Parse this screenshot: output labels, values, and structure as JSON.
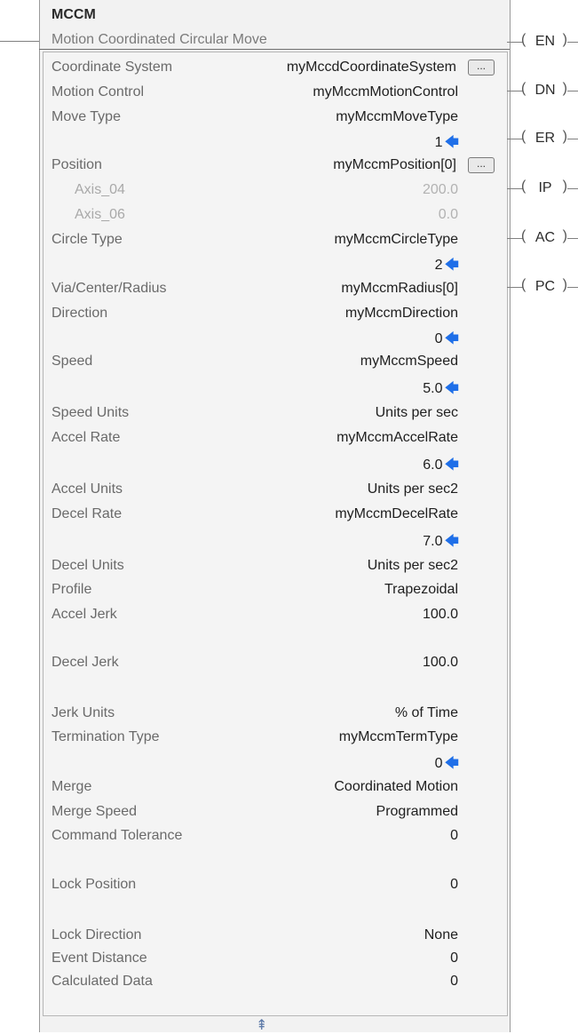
{
  "instruction": {
    "mnemonic": "MCCM",
    "description": "Motion Coordinated Circular Move"
  },
  "params": {
    "coordinate_system": {
      "label": "Coordinate System",
      "value": "myMccdCoordinateSystem"
    },
    "motion_control": {
      "label": "Motion Control",
      "value": "myMccmMotionControl"
    },
    "move_type": {
      "label": "Move Type",
      "value": "myMccmMoveType",
      "current": "1"
    },
    "position": {
      "label": "Position",
      "value": "myMccmPosition[0]"
    },
    "axis_04": {
      "label": "Axis_04",
      "value": "200.0"
    },
    "axis_06": {
      "label": "Axis_06",
      "value": "0.0"
    },
    "circle_type": {
      "label": "Circle Type",
      "value": "myMccmCircleType",
      "current": "2"
    },
    "via_center_radius": {
      "label": "Via/Center/Radius",
      "value": "myMccmRadius[0]"
    },
    "direction": {
      "label": "Direction",
      "value": "myMccmDirection",
      "current": "0"
    },
    "speed": {
      "label": "Speed",
      "value": "myMccmSpeed",
      "current": "5.0"
    },
    "speed_units": {
      "label": "Speed Units",
      "value": "Units per sec"
    },
    "accel_rate": {
      "label": "Accel Rate",
      "value": "myMccmAccelRate",
      "current": "6.0"
    },
    "accel_units": {
      "label": "Accel Units",
      "value": "Units per sec2"
    },
    "decel_rate": {
      "label": "Decel Rate",
      "value": "myMccmDecelRate",
      "current": "7.0"
    },
    "decel_units": {
      "label": "Decel Units",
      "value": "Units per sec2"
    },
    "profile": {
      "label": "Profile",
      "value": "Trapezoidal"
    },
    "accel_jerk": {
      "label": "Accel Jerk",
      "value": "100.0"
    },
    "decel_jerk": {
      "label": "Decel Jerk",
      "value": "100.0"
    },
    "jerk_units": {
      "label": "Jerk Units",
      "value": "% of Time"
    },
    "termination_type": {
      "label": "Termination Type",
      "value": "myMccmTermType",
      "current": "0"
    },
    "merge": {
      "label": "Merge",
      "value": "Coordinated Motion"
    },
    "merge_speed": {
      "label": "Merge Speed",
      "value": "Programmed"
    },
    "command_tolerance": {
      "label": "Command Tolerance",
      "value": "0"
    },
    "lock_position": {
      "label": "Lock Position",
      "value": "0"
    },
    "lock_direction": {
      "label": "Lock Direction",
      "value": "None"
    },
    "event_distance": {
      "label": "Event Distance",
      "value": "0"
    },
    "calculated_data": {
      "label": "Calculated Data",
      "value": "0"
    }
  },
  "outputs": {
    "en": "EN",
    "dn": "DN",
    "er": "ER",
    "ip": "IP",
    "ac": "AC",
    "pc": "PC"
  },
  "buttons": {
    "ellipsis": "..."
  },
  "icons": {
    "collapse": "double-chevron-up-icon",
    "arrow": "left-arrow-icon",
    "arrow_color": "#1f6fe8"
  },
  "glyphs": {
    "arrow": "🡄",
    "collapse": "⇞"
  }
}
